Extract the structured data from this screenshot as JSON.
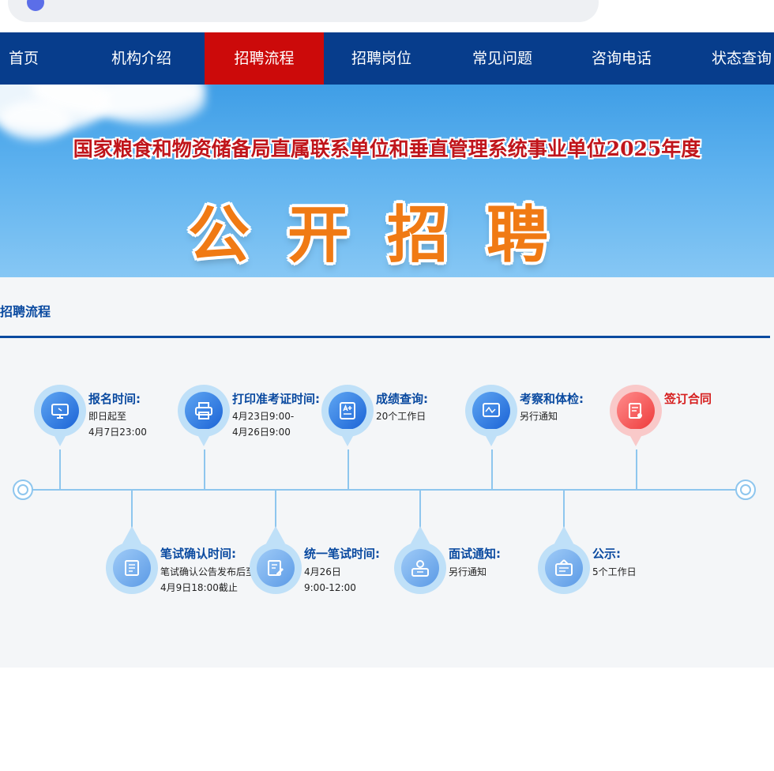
{
  "nav": {
    "items": [
      "首页",
      "机构介绍",
      "招聘流程",
      "招聘岗位",
      "常见问题",
      "咨询电话",
      "状态查询"
    ],
    "active_index": 2
  },
  "banner": {
    "subtitle": "国家粮食和物资储备局直属联系单位和垂直管理系统事业单位2025年度",
    "title": "公开招聘"
  },
  "section": {
    "title": "招聘流程"
  },
  "steps": [
    {
      "title": "报名时间:",
      "lines": [
        "即日起至",
        "4月7日23:00"
      ],
      "icon": "monitor-icon"
    },
    {
      "title": "打印准考证时间:",
      "lines": [
        "4月23日9:00-",
        "4月26日9:00"
      ],
      "icon": "printer-icon"
    },
    {
      "title": "成绩查询:",
      "lines": [
        "20个工作日"
      ],
      "icon": "score-icon"
    },
    {
      "title": "考察和体检:",
      "lines": [
        "另行通知"
      ],
      "icon": "health-check-icon"
    },
    {
      "title": "签订合同",
      "lines": [],
      "icon": "contract-icon"
    },
    {
      "title": "笔试确认时间:",
      "lines": [
        "笔试确认公告发布后至",
        "4月9日18:00截止"
      ],
      "icon": "document-icon"
    },
    {
      "title": "统一笔试时间:",
      "lines": [
        "4月26日",
        "9:00-12:00"
      ],
      "icon": "edit-icon"
    },
    {
      "title": "面试通知:",
      "lines": [
        "另行通知"
      ],
      "icon": "interview-icon"
    },
    {
      "title": "公示:",
      "lines": [
        "5个工作日"
      ],
      "icon": "notice-board-icon"
    }
  ],
  "colors": {
    "nav_bg": "#073d8c",
    "nav_active": "#cc0a0a",
    "accent": "#0a4aa0",
    "highlight": "#d61f1f"
  }
}
